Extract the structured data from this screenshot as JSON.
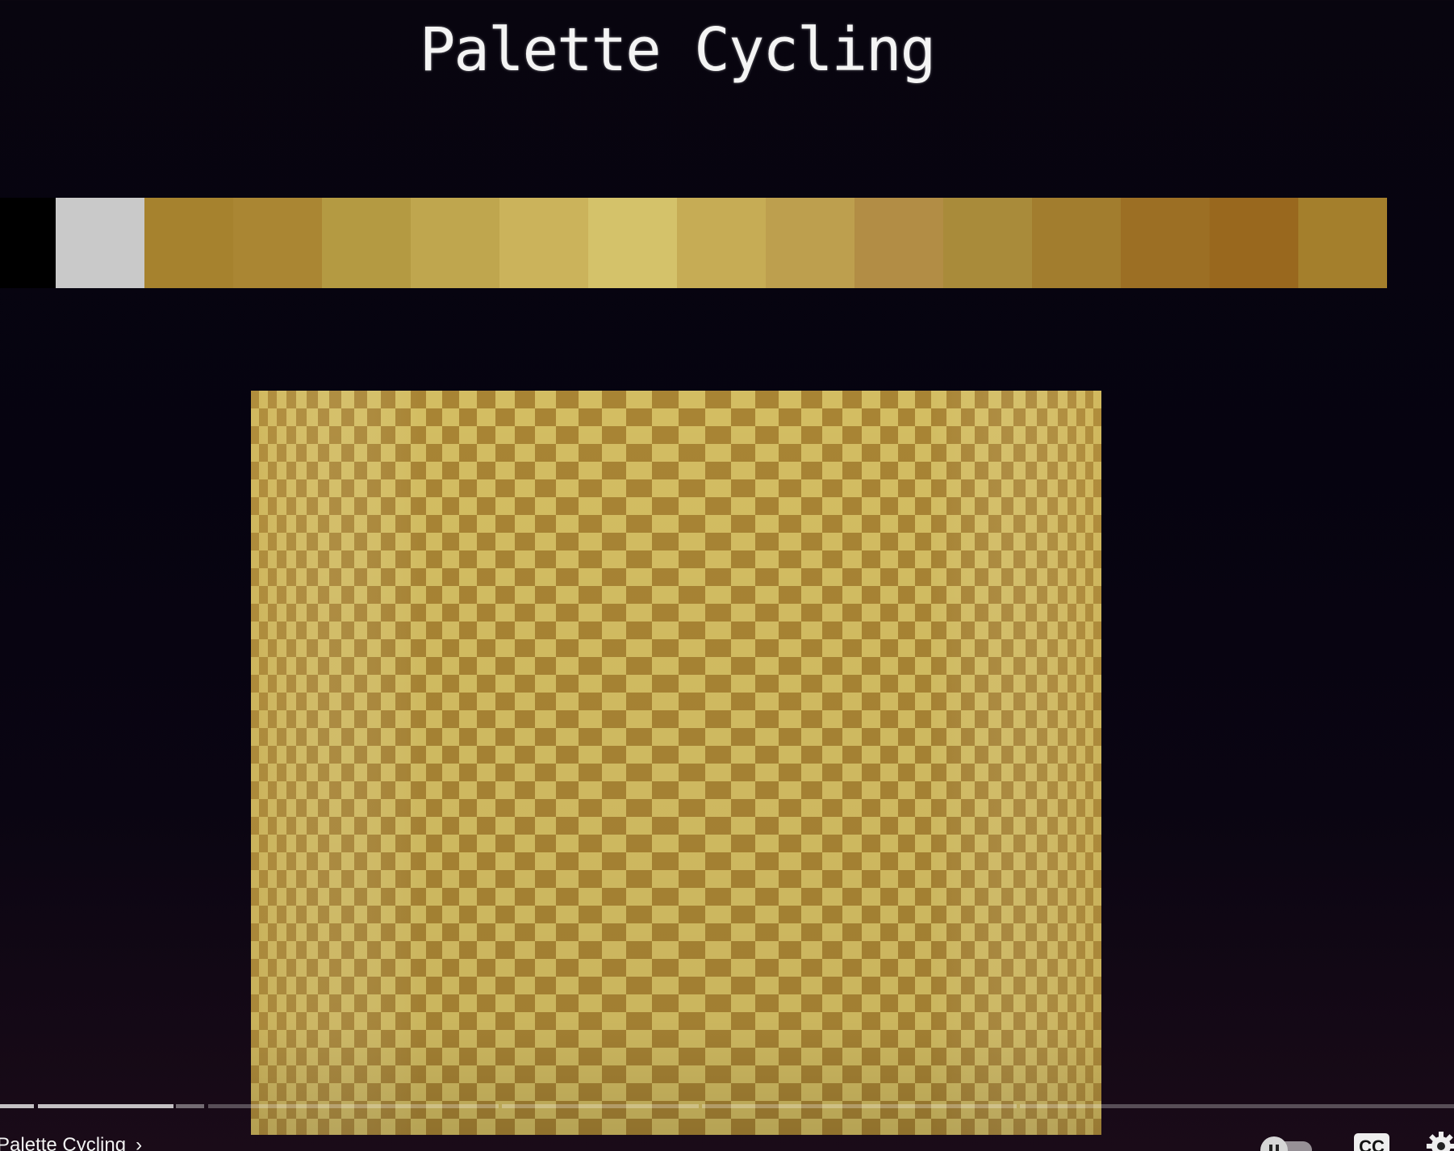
{
  "video": {
    "title": "Palette Cycling"
  },
  "palette": {
    "swatches": [
      "#000000",
      "#c9c9c9",
      "#a6822e",
      "#aa8633",
      "#b49a42",
      "#bfa64e",
      "#cbb35b",
      "#d4c26a",
      "#c6ac55",
      "#bd9f4e",
      "#b28d45",
      "#a98b3a",
      "#a27d2e",
      "#9c6f24",
      "#99681e",
      "#a47f2c"
    ]
  },
  "animation": {
    "light_color": "#d3bd62",
    "dark_color": "#a88434"
  },
  "player": {
    "chapter_label": "Palette Cycling",
    "chapter_chevron": "›",
    "cc_label": "CC"
  }
}
